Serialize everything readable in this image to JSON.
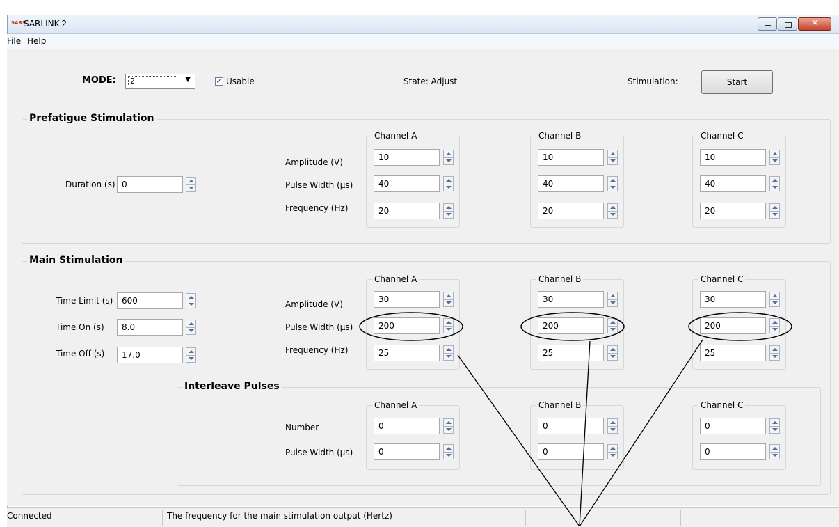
{
  "window": {
    "title": "SARLINK-2",
    "icon_name": "sarlink-app-icon",
    "icon_text": "SARS",
    "min_label": "",
    "close_label": "✕"
  },
  "menu": {
    "file": "File",
    "help": "Help"
  },
  "top": {
    "mode_label": "MODE:",
    "mode_value": "2",
    "mode_arrow": "▼",
    "usable_checked": "✓",
    "usable_label": "Usable",
    "state_text": "State: Adjust",
    "stimulation_label": "Stimulation:",
    "start_label": "Start"
  },
  "prefatigue": {
    "title": "Prefatigue Stimulation",
    "duration_label": "Duration (s)",
    "duration_value": "0",
    "row_labels": [
      "Amplitude (V)",
      "Pulse Width (µs)",
      "Frequency (Hz)"
    ],
    "channels": [
      {
        "name": "Channel A",
        "amplitude": "10",
        "pulse_width": "40",
        "frequency": "20"
      },
      {
        "name": "Channel B",
        "amplitude": "10",
        "pulse_width": "40",
        "frequency": "20"
      },
      {
        "name": "Channel C",
        "amplitude": "10",
        "pulse_width": "40",
        "frequency": "20"
      }
    ]
  },
  "main": {
    "title": "Main Stimulation",
    "time_limit_label": "Time Limit (s)",
    "time_limit_value": "600",
    "time_on_label": "Time On (s)",
    "time_on_value": "8.0",
    "time_off_label": "Time Off (s)",
    "time_off_value": "17.0",
    "row_labels": [
      "Amplitude (V)",
      "Pulse Width (µs)",
      "Frequency (Hz)"
    ],
    "channels": [
      {
        "name": "Channel A",
        "amplitude": "30",
        "pulse_width": "200",
        "frequency": "25"
      },
      {
        "name": "Channel B",
        "amplitude": "30",
        "pulse_width": "200",
        "frequency": "25"
      },
      {
        "name": "Channel C",
        "amplitude": "30",
        "pulse_width": "200",
        "frequency": "25"
      }
    ]
  },
  "interleave": {
    "title": "Interleave Pulses",
    "row_labels": [
      "Number",
      "Pulse Width (µs)"
    ],
    "channels": [
      {
        "name": "Channel A",
        "number": "0",
        "pulse_width": "0"
      },
      {
        "name": "Channel B",
        "number": "0",
        "pulse_width": "0"
      },
      {
        "name": "Channel C",
        "number": "0",
        "pulse_width": "0"
      }
    ]
  },
  "status": {
    "connection": "Connected",
    "hint": "The frequency for the main stimulation output (Hertz)"
  },
  "colors": {
    "title_bar": "#dbe6f3",
    "client_bg": "#f0f0f0",
    "close_button": "#c7412b",
    "annotation": "#000000"
  }
}
